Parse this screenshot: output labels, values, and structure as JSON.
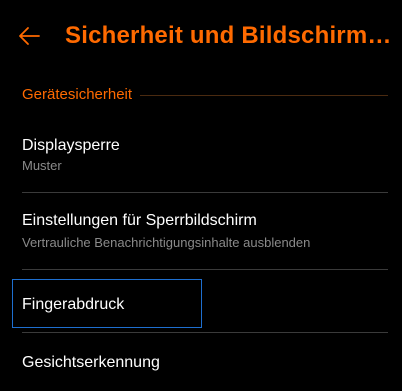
{
  "colors": {
    "accent": "#ff6a00",
    "background": "#000000",
    "text_primary": "#ffffff",
    "text_secondary": "#8a8a8a",
    "divider": "#3a3a3a",
    "focus_outline": "#1e6fd0"
  },
  "header": {
    "back_icon": "arrow-left-icon",
    "title": "Sicherheit und Bildschirm…"
  },
  "section": {
    "title": "Gerätesicherheit"
  },
  "items": [
    {
      "title": "Displaysperre",
      "subtitle": "Muster"
    },
    {
      "title": "Einstellungen für Sperrbildschirm",
      "subtitle": "Vertrauliche Benachrichtigungsinhalte ausblenden"
    },
    {
      "title": "Fingerabdruck",
      "subtitle": ""
    },
    {
      "title": "Gesichtserkennung",
      "subtitle": ""
    }
  ]
}
